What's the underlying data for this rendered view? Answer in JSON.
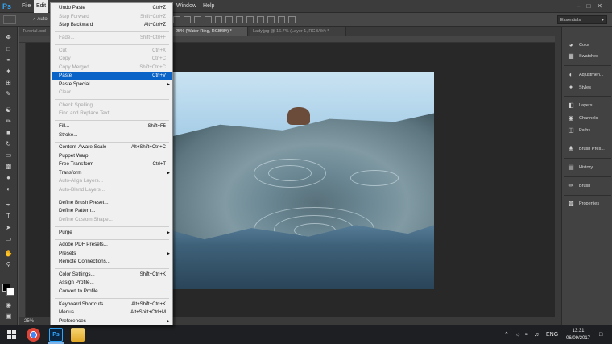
{
  "app": {
    "logo": "Ps",
    "menus": [
      "File",
      "Edit",
      "Window",
      "Help"
    ],
    "active_menu": "Edit"
  },
  "options_bar": {
    "auto_select_label": "Auto",
    "workspace": "Essentials"
  },
  "tabs": [
    {
      "label": "Turorial.psd"
    },
    {
      "label": "25% (Water Ring, RGB/8#) *"
    },
    {
      "label": "Lady.jpg @ 16.7% (Layer 1, RGB/8#) *"
    }
  ],
  "status": {
    "zoom": "25%"
  },
  "edit_menu": {
    "items": [
      {
        "label": "Undo Paste",
        "shortcut": "Ctrl+Z",
        "disabled": false
      },
      {
        "label": "Step Forward",
        "shortcut": "Shift+Ctrl+Z",
        "disabled": true
      },
      {
        "label": "Step Backward",
        "shortcut": "Alt+Ctrl+Z",
        "disabled": false
      },
      {
        "label": "Fade...",
        "shortcut": "Shift+Ctrl+F",
        "disabled": true
      },
      {
        "label": "Cut",
        "shortcut": "Ctrl+X",
        "disabled": true
      },
      {
        "label": "Copy",
        "shortcut": "Ctrl+C",
        "disabled": true
      },
      {
        "label": "Copy Merged",
        "shortcut": "Shift+Ctrl+C",
        "disabled": true
      },
      {
        "label": "Paste",
        "shortcut": "Ctrl+V",
        "disabled": false,
        "highlighted": true
      },
      {
        "label": "Paste Special",
        "shortcut": "",
        "submenu": true
      },
      {
        "label": "Clear",
        "shortcut": "",
        "disabled": true
      },
      {
        "label": "Check Spelling...",
        "shortcut": "",
        "disabled": true
      },
      {
        "label": "Find and Replace Text...",
        "shortcut": "",
        "disabled": true
      },
      {
        "label": "Fill...",
        "shortcut": "Shift+F5"
      },
      {
        "label": "Stroke...",
        "shortcut": ""
      },
      {
        "label": "Content-Aware Scale",
        "shortcut": "Alt+Shift+Ctrl+C"
      },
      {
        "label": "Puppet Warp",
        "shortcut": ""
      },
      {
        "label": "Free Transform",
        "shortcut": "Ctrl+T"
      },
      {
        "label": "Transform",
        "shortcut": "",
        "submenu": true
      },
      {
        "label": "Auto-Align Layers...",
        "shortcut": "",
        "disabled": true
      },
      {
        "label": "Auto-Blend Layers...",
        "shortcut": "",
        "disabled": true
      },
      {
        "label": "Define Brush Preset...",
        "shortcut": ""
      },
      {
        "label": "Define Pattern...",
        "shortcut": ""
      },
      {
        "label": "Define Custom Shape...",
        "shortcut": "",
        "disabled": true
      },
      {
        "label": "Purge",
        "shortcut": "",
        "submenu": true
      },
      {
        "label": "Adobe PDF Presets...",
        "shortcut": ""
      },
      {
        "label": "Presets",
        "shortcut": "",
        "submenu": true
      },
      {
        "label": "Remote Connections...",
        "shortcut": ""
      },
      {
        "label": "Color Settings...",
        "shortcut": "Shift+Ctrl+K"
      },
      {
        "label": "Assign Profile...",
        "shortcut": ""
      },
      {
        "label": "Convert to Profile...",
        "shortcut": ""
      },
      {
        "label": "Keyboard Shortcuts...",
        "shortcut": "Alt+Shift+Ctrl+K"
      },
      {
        "label": "Menus...",
        "shortcut": "Alt+Shift+Ctrl+M"
      },
      {
        "label": "Preferences",
        "shortcut": "",
        "submenu": true
      }
    ]
  },
  "panels": [
    {
      "label": "Color",
      "icon": "color-wheel-icon"
    },
    {
      "label": "Swatches",
      "icon": "swatches-icon"
    },
    {
      "label": "Adjustmen...",
      "icon": "adjustments-icon"
    },
    {
      "label": "Styles",
      "icon": "styles-icon"
    },
    {
      "label": "Layers",
      "icon": "layers-icon"
    },
    {
      "label": "Channels",
      "icon": "channels-icon"
    },
    {
      "label": "Paths",
      "icon": "paths-icon"
    },
    {
      "label": "Brush Pres...",
      "icon": "brush-presets-icon"
    },
    {
      "label": "History",
      "icon": "history-icon"
    },
    {
      "label": "Brush",
      "icon": "brush-icon"
    },
    {
      "label": "Properties",
      "icon": "properties-icon"
    }
  ],
  "taskbar": {
    "lang": "ENG",
    "time": "13:31",
    "date": "06/09/2017",
    "ps_label": "Ps"
  },
  "colors": {
    "highlight": "#0a64c8",
    "ps_blue": "#31a8ff",
    "fg_swatch": "#000000",
    "bg_swatch": "#ffffff"
  }
}
